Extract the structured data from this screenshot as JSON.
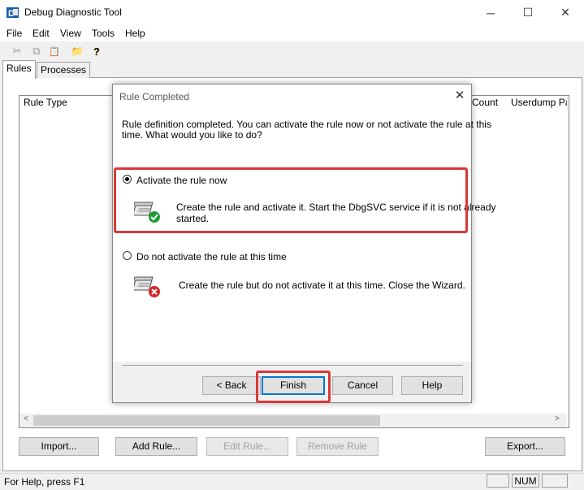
{
  "window": {
    "title": "Debug Diagnostic Tool",
    "minimize": "─",
    "maximize": "☐",
    "close": "✕"
  },
  "menu": [
    "File",
    "Edit",
    "View",
    "Tools",
    "Help"
  ],
  "toolbar": {
    "cut": "✂",
    "copy": "⧉",
    "paste": "📋",
    "open": "📁",
    "help": "?"
  },
  "tabs": [
    "Rules",
    "Processes"
  ],
  "list": {
    "columns": [
      "Rule Type",
      "Count",
      "Userdump Pat"
    ]
  },
  "scroll": {
    "left": "<",
    "right": ">"
  },
  "buttons": {
    "import": "Import...",
    "add_rule": "Add Rule...",
    "edit_rule": "Edit Rule...",
    "remove_rule": "Remove Rule",
    "export": "Export..."
  },
  "status": {
    "text": "For Help, press F1",
    "num": "NUM"
  },
  "dialog": {
    "title": "Rule Completed",
    "close": "✕",
    "intro_line1": "Rule definition completed. You can activate the rule now or not activate the rule at this",
    "intro_line2": "time. What would you like to do?",
    "option_activate": {
      "label": "Activate the rule now",
      "desc_line1": "Create the rule and activate it. Start the DbgSVC service if it is not already",
      "desc_line2": "started."
    },
    "option_deactivate": {
      "label": "Do not activate the rule at this time",
      "desc": "Create the rule but do not activate it at this time. Close the Wizard."
    },
    "back": "< Back",
    "finish": "Finish",
    "cancel": "Cancel",
    "help": "Help"
  },
  "colors": {
    "highlight": "#d9383a",
    "accent": "#0078d7"
  }
}
